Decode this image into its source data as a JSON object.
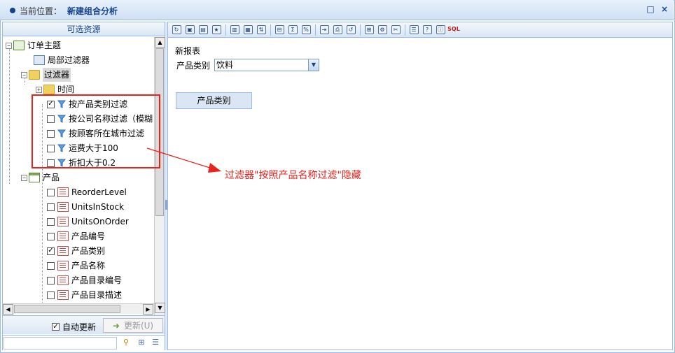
{
  "titlebar": {
    "location_label": "当前位置：",
    "location_value": "新建组合分析",
    "maximize_glyph": "□",
    "close_glyph": "×"
  },
  "left_panel": {
    "header": "可选资源",
    "tree": {
      "root": "订单主题",
      "local_filter": "局部过滤器",
      "filters_folder": "过滤器",
      "time_folder": "时间",
      "filters": [
        {
          "label": "按产品类别过滤",
          "checked": true
        },
        {
          "label": "按公司名称过滤（模糊",
          "checked": false
        },
        {
          "label": "按顾客所在城市过滤",
          "checked": false
        },
        {
          "label": "运费大于100",
          "checked": false
        },
        {
          "label": "折扣大于0.2",
          "checked": false
        }
      ],
      "product_table": "产品",
      "product_fields": [
        {
          "label": "ReorderLevel",
          "checked": false
        },
        {
          "label": "UnitsInStock",
          "checked": false
        },
        {
          "label": "UnitsOnOrder",
          "checked": false
        },
        {
          "label": "产品编号",
          "checked": false
        },
        {
          "label": "产品类别",
          "checked": true
        },
        {
          "label": "产品名称",
          "checked": false
        },
        {
          "label": "产品目录编号",
          "checked": false
        },
        {
          "label": "产品目录描述",
          "checked": false
        }
      ]
    },
    "auto_update_label": "自动更新",
    "auto_update_checked": true,
    "refresh_label": "更新(U)",
    "search_placeholder": ""
  },
  "toolbar": {
    "icons": [
      "refresh-icon",
      "save-icon",
      "save-as-icon",
      "favorite-icon",
      "chart-icon",
      "layout-icon",
      "sort-icon",
      "filter-icon",
      "sum-icon",
      "calc-icon",
      "export-icon",
      "print-icon",
      "reload-icon",
      "param-icon",
      "measure-icon",
      "tools-icon",
      "properties-icon",
      "help-icon",
      "info-icon",
      "sql-icon"
    ],
    "sql_text": "SQL"
  },
  "report": {
    "title": "新报表",
    "param_label": "产品类别",
    "param_value": "饮料",
    "dimension_field": "产品类别"
  },
  "annotation": {
    "text": "过滤器\"按照产品名称过滤\"隐藏",
    "color": "#e8221c"
  }
}
